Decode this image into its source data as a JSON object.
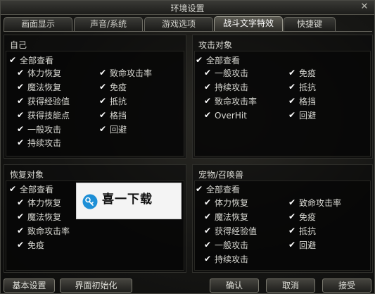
{
  "window": {
    "title": "环境设置",
    "close_glyph": "✕"
  },
  "tabs": [
    {
      "label": "画面显示"
    },
    {
      "label": "声音/系统"
    },
    {
      "label": "游戏选项"
    },
    {
      "label": "战斗文字特效"
    },
    {
      "label": "快捷键"
    }
  ],
  "active_tab": "战斗文字特效",
  "panels": {
    "self": {
      "title": "自己",
      "items": [
        {
          "label": "全部查看",
          "checked": true
        },
        {
          "label": "体力恢复",
          "checked": true
        },
        {
          "label": "魔法恢复",
          "checked": true
        },
        {
          "label": "获得经验值",
          "checked": true
        },
        {
          "label": "获得技能点",
          "checked": true
        },
        {
          "label": "一般攻击",
          "checked": true
        },
        {
          "label": "持续攻击",
          "checked": true
        },
        {
          "label": "致命攻击率",
          "checked": true
        },
        {
          "label": "免疫",
          "checked": true
        },
        {
          "label": "抵抗",
          "checked": true
        },
        {
          "label": "格挡",
          "checked": true
        },
        {
          "label": "回避",
          "checked": true
        }
      ]
    },
    "target": {
      "title": "攻击对象",
      "items": [
        {
          "label": "全部查看",
          "checked": true
        },
        {
          "label": "一般攻击",
          "checked": true
        },
        {
          "label": "持续攻击",
          "checked": true
        },
        {
          "label": "致命攻击率",
          "checked": true
        },
        {
          "label": "OverHit",
          "checked": true
        },
        {
          "label": "免疫",
          "checked": true
        },
        {
          "label": "抵抗",
          "checked": true
        },
        {
          "label": "格挡",
          "checked": true
        },
        {
          "label": "回避",
          "checked": true
        }
      ]
    },
    "recovery": {
      "title": "恢复对象",
      "items": [
        {
          "label": "全部查看",
          "checked": true
        },
        {
          "label": "体力恢复",
          "checked": true
        },
        {
          "label": "魔法恢复",
          "checked": true
        },
        {
          "label": "致命攻击率",
          "checked": true
        },
        {
          "label": "免疫",
          "checked": true
        }
      ]
    },
    "pet": {
      "title": "宠物/召唤兽",
      "items": [
        {
          "label": "全部查看",
          "checked": true
        },
        {
          "label": "体力恢复",
          "checked": true
        },
        {
          "label": "魔法恢复",
          "checked": true
        },
        {
          "label": "获得经验值",
          "checked": true
        },
        {
          "label": "一般攻击",
          "checked": true
        },
        {
          "label": "持续攻击",
          "checked": true
        },
        {
          "label": "致命攻击率",
          "checked": true
        },
        {
          "label": "免疫",
          "checked": true
        },
        {
          "label": "抵抗",
          "checked": true
        },
        {
          "label": "回避",
          "checked": true
        }
      ]
    }
  },
  "check_glyph": "✔",
  "watermark": {
    "text": "喜一下载",
    "accent": "#1e8fd6"
  },
  "buttons": {
    "basic": "基本设置",
    "reset_ui": "界面初始化",
    "ok": "确认",
    "cancel": "取消",
    "apply": "接受"
  }
}
